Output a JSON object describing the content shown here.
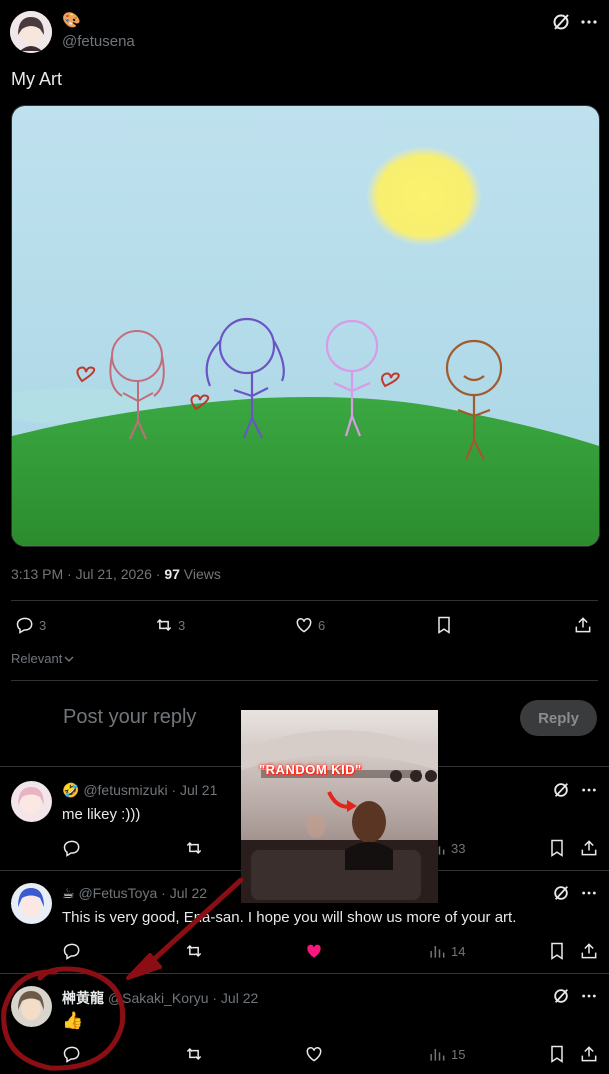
{
  "post": {
    "emoji": "🎨",
    "handle": "@fetusena",
    "text": "My Art",
    "timestamp": "3:13 PM · Jul 21, 2026 · ",
    "views_count": "97",
    "views_label": " Views",
    "stats": {
      "replies": "3",
      "reposts": "3",
      "likes": "6"
    }
  },
  "sort": {
    "label": "Relevant"
  },
  "composer": {
    "placeholder": "Post your reply",
    "button": "Reply"
  },
  "overlay": {
    "caption": "\"RANDOM KID\""
  },
  "replies": [
    {
      "emoji": "🤣",
      "handle": "@fetusmizuki",
      "date": " · Jul 21",
      "text": "me likey :)))",
      "views": "33"
    },
    {
      "emoji": "☕",
      "handle": "@FetusToya",
      "date": " · Jul 22",
      "text": "This is very good, Ena-san. I hope you will show us more of your art.",
      "views": "14",
      "liked": true
    },
    {
      "name": "榊黄龍",
      "handle": "@Sakaki_Koryu",
      "date": " · Jul 22",
      "text": "👍",
      "views": "15"
    }
  ],
  "colors": {
    "bg": "#000000",
    "text": "#e7e9ea",
    "muted": "#71767b",
    "like_red": "#f91880",
    "annotation_red": "#8b0e14"
  }
}
